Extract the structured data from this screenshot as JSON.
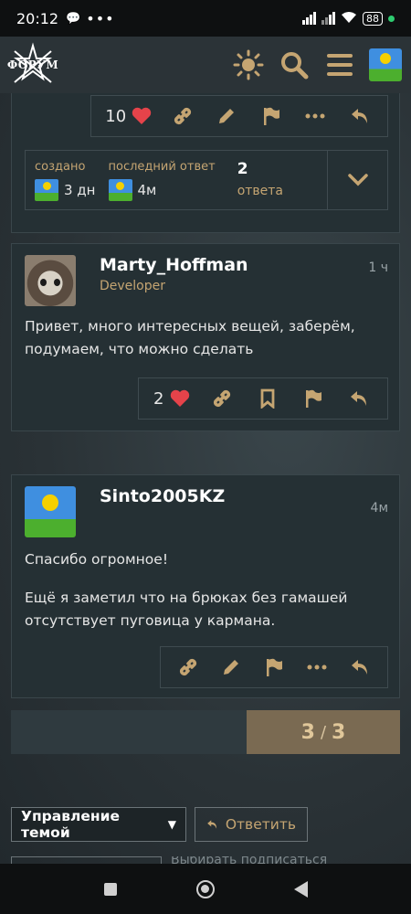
{
  "status_bar": {
    "time": "20:12",
    "notif_dots": "•••",
    "battery": "88"
  },
  "header": {
    "logo_text": "ФОРУМ",
    "accent": "#c5a572"
  },
  "top_post": {
    "likes": "10",
    "meta": {
      "created_label": "создано",
      "created_value": "3 дн",
      "last_reply_label": "последний ответ",
      "last_reply_value": "4м",
      "replies_count": "2",
      "replies_word": "ответа"
    }
  },
  "post2": {
    "username": "Marty_Hoffman",
    "user_title": "Developer",
    "time": "1 ч",
    "body": "Привет, много интересных вещей, заберём, подумаем, что можно сделать",
    "likes": "2"
  },
  "post3": {
    "username": "Sinto2005KZ",
    "time": "4м",
    "body_p1": "Спасибо огромное!",
    "body_p2": "Ещё я заметил что на брюках без гамашей отсутствует пуговица у кармана."
  },
  "pager": {
    "current": "3",
    "separator": "/",
    "total": "3"
  },
  "footer": {
    "manage_label": "Управление темой",
    "reply_label": "Ответить",
    "partial_text": "Выбирать подписаться"
  }
}
